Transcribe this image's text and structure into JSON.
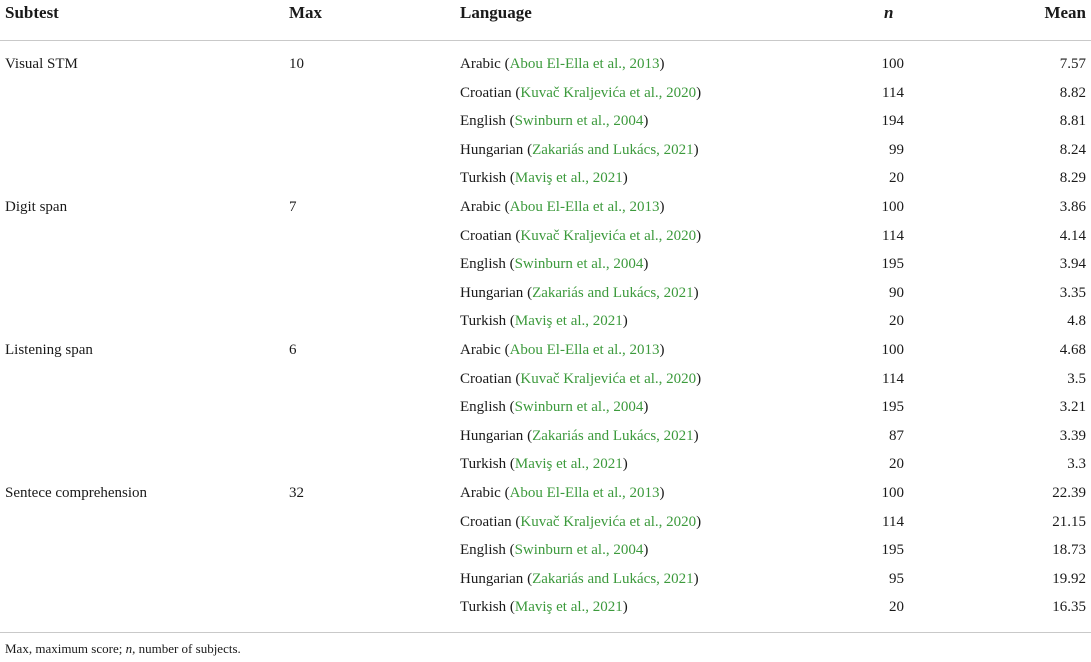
{
  "headers": {
    "subtest": "Subtest",
    "max": "Max",
    "language": "Language",
    "n": "n",
    "mean": "Mean"
  },
  "groups": [
    {
      "subtest": "Visual STM",
      "max": "10",
      "rows": [
        {
          "language": "Arabic",
          "citation": "Abou El-Ella et al., 2013",
          "n": "100",
          "mean": "7.57"
        },
        {
          "language": "Croatian",
          "citation": "Kuvač Kraljevića et al., 2020",
          "n": "114",
          "mean": "8.82"
        },
        {
          "language": "English",
          "citation": "Swinburn et al., 2004",
          "n": "194",
          "mean": "8.81"
        },
        {
          "language": "Hungarian",
          "citation": "Zakariás and Lukács, 2021",
          "n": "99",
          "mean": "8.24"
        },
        {
          "language": "Turkish",
          "citation": "Maviş et al., 2021",
          "n": "20",
          "mean": "8.29"
        }
      ]
    },
    {
      "subtest": "Digit span",
      "max": "7",
      "rows": [
        {
          "language": "Arabic",
          "citation": "Abou El-Ella et al., 2013",
          "n": "100",
          "mean": "3.86"
        },
        {
          "language": "Croatian",
          "citation": "Kuvač Kraljevića et al., 2020",
          "n": "114",
          "mean": "4.14"
        },
        {
          "language": "English",
          "citation": "Swinburn et al., 2004",
          "n": "195",
          "mean": "3.94"
        },
        {
          "language": "Hungarian",
          "citation": "Zakariás and Lukács, 2021",
          "n": "90",
          "mean": "3.35"
        },
        {
          "language": "Turkish",
          "citation": "Maviş et al., 2021",
          "n": "20",
          "mean": "4.8"
        }
      ]
    },
    {
      "subtest": "Listening span",
      "max": "6",
      "rows": [
        {
          "language": "Arabic",
          "citation": "Abou El-Ella et al., 2013",
          "n": "100",
          "mean": "4.68"
        },
        {
          "language": "Croatian",
          "citation": "Kuvač Kraljevića et al., 2020",
          "n": "114",
          "mean": "3.5"
        },
        {
          "language": "English",
          "citation": "Swinburn et al., 2004",
          "n": "195",
          "mean": "3.21"
        },
        {
          "language": "Hungarian",
          "citation": "Zakariás and Lukács, 2021",
          "n": "87",
          "mean": "3.39"
        },
        {
          "language": "Turkish",
          "citation": "Maviş et al., 2021",
          "n": "20",
          "mean": "3.3"
        }
      ]
    },
    {
      "subtest": "Sentece comprehension",
      "max": "32",
      "rows": [
        {
          "language": "Arabic",
          "citation": "Abou El-Ella et al., 2013",
          "n": "100",
          "mean": "22.39"
        },
        {
          "language": "Croatian",
          "citation": "Kuvač Kraljevića et al., 2020",
          "n": "114",
          "mean": "21.15"
        },
        {
          "language": "English",
          "citation": "Swinburn et al., 2004",
          "n": "195",
          "mean": "18.73"
        },
        {
          "language": "Hungarian",
          "citation": "Zakariás and Lukács, 2021",
          "n": "95",
          "mean": "19.92"
        },
        {
          "language": "Turkish",
          "citation": "Maviş et al., 2021",
          "n": "20",
          "mean": "16.35"
        }
      ]
    }
  ],
  "footnote": {
    "part1": "Max, maximum score; ",
    "n_symbol": "n",
    "part2": ", number of subjects."
  },
  "colors": {
    "citation": "#3c9a3c",
    "rule": "#c9c9c9"
  }
}
